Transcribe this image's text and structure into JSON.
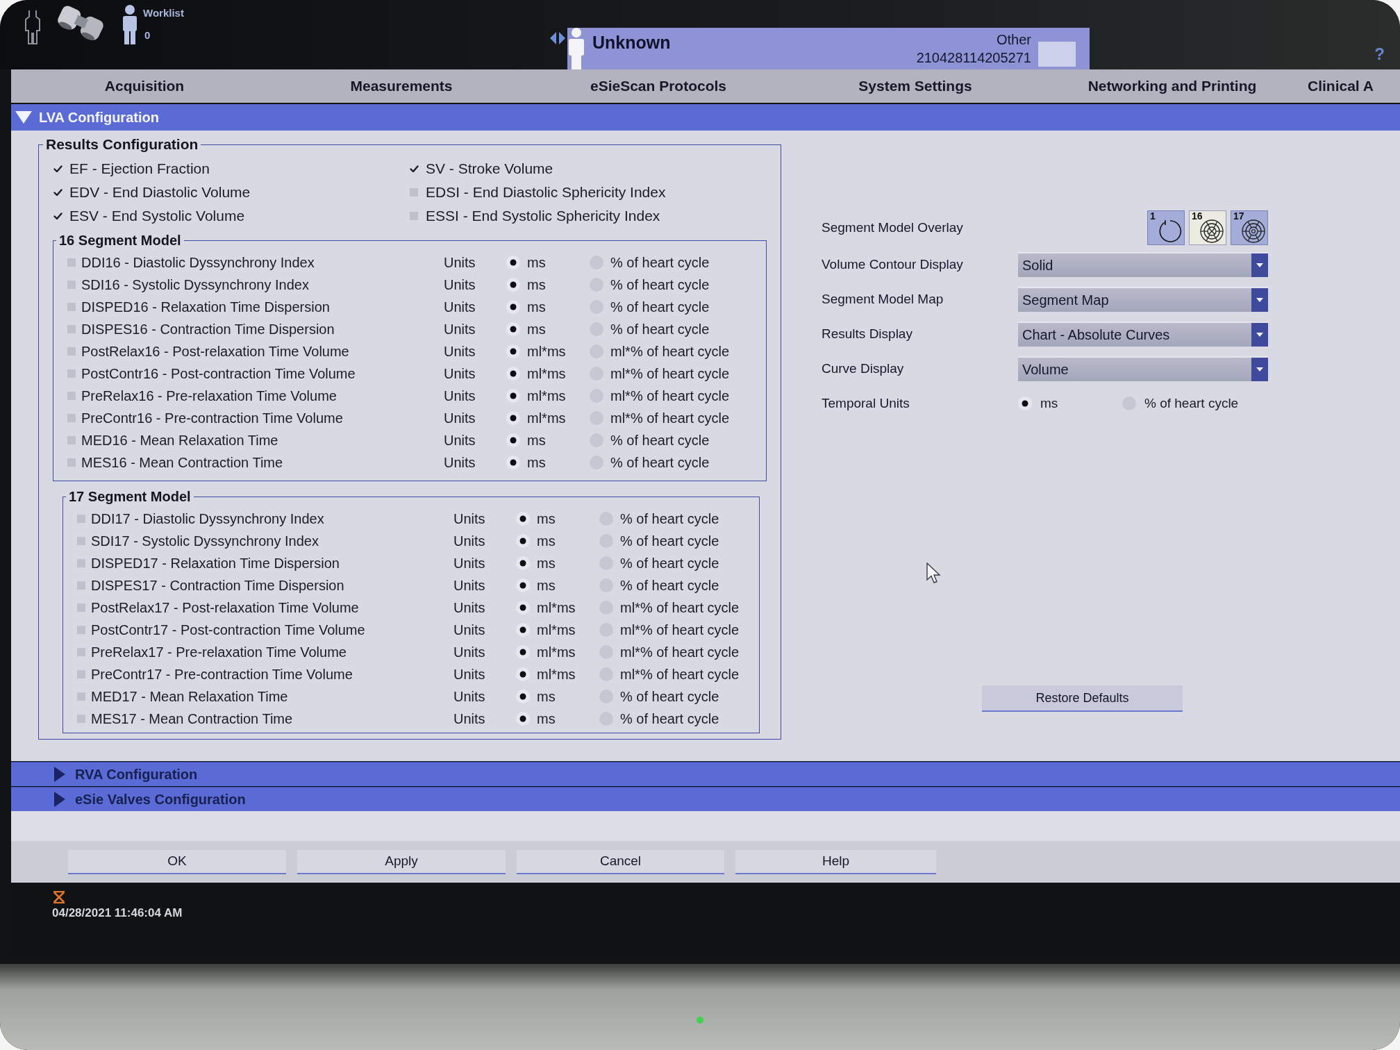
{
  "header": {
    "worklist_label": "Worklist",
    "worklist_count": "0",
    "patient": {
      "name": "Unknown",
      "type": "Other",
      "id": "210428114205271"
    },
    "help": "?"
  },
  "tabs": [
    {
      "label": "Acquisition"
    },
    {
      "label": "Measurements"
    },
    {
      "label": "eSieScan Protocols"
    },
    {
      "label": "System Settings"
    },
    {
      "label": "Networking and Printing"
    },
    {
      "label": "Clinical A"
    }
  ],
  "sections": [
    {
      "title": "LVA Configuration",
      "expanded": true,
      "results_configuration": {
        "title": "Results Configuration",
        "measures_left": [
          {
            "label": "EF - Ejection Fraction",
            "checked": true
          },
          {
            "label": "EDV - End Diastolic Volume",
            "checked": true
          },
          {
            "label": "ESV - End Systolic Volume",
            "checked": true
          }
        ],
        "measures_right": [
          {
            "label": "SV - Stroke Volume",
            "checked": true
          },
          {
            "label": "EDSI - End Diastolic Sphericity Index",
            "checked": false
          },
          {
            "label": "ESSI - End Systolic Sphericity Index",
            "checked": false
          }
        ],
        "segment_models": [
          {
            "title": "16 Segment Model",
            "rows": [
              {
                "label": "DDI16 - Diastolic Dyssynchrony Index",
                "checked": false,
                "units_label": "Units",
                "options": [
                  {
                    "label": "ms",
                    "selected": true
                  },
                  {
                    "label": "% of heart cycle",
                    "selected": false
                  }
                ]
              },
              {
                "label": "SDI16 - Systolic Dyssynchrony Index",
                "checked": false,
                "units_label": "Units",
                "options": [
                  {
                    "label": "ms",
                    "selected": true
                  },
                  {
                    "label": "% of heart cycle",
                    "selected": false
                  }
                ]
              },
              {
                "label": "DISPED16 - Relaxation Time Dispersion",
                "checked": false,
                "units_label": "Units",
                "options": [
                  {
                    "label": "ms",
                    "selected": true
                  },
                  {
                    "label": "% of heart cycle",
                    "selected": false
                  }
                ]
              },
              {
                "label": "DISPES16 - Contraction Time Dispersion",
                "checked": false,
                "units_label": "Units",
                "options": [
                  {
                    "label": "ms",
                    "selected": true
                  },
                  {
                    "label": "% of heart cycle",
                    "selected": false
                  }
                ]
              },
              {
                "label": "PostRelax16 - Post-relaxation Time Volume",
                "checked": false,
                "units_label": "Units",
                "options": [
                  {
                    "label": "ml*ms",
                    "selected": true
                  },
                  {
                    "label": "ml*% of heart cycle",
                    "selected": false
                  }
                ]
              },
              {
                "label": "PostContr16 - Post-contraction Time Volume",
                "checked": false,
                "units_label": "Units",
                "options": [
                  {
                    "label": "ml*ms",
                    "selected": true
                  },
                  {
                    "label": "ml*% of heart cycle",
                    "selected": false
                  }
                ]
              },
              {
                "label": "PreRelax16 - Pre-relaxation Time Volume",
                "checked": false,
                "units_label": "Units",
                "options": [
                  {
                    "label": "ml*ms",
                    "selected": true
                  },
                  {
                    "label": "ml*% of heart cycle",
                    "selected": false
                  }
                ]
              },
              {
                "label": "PreContr16 - Pre-contraction Time Volume",
                "checked": false,
                "units_label": "Units",
                "options": [
                  {
                    "label": "ml*ms",
                    "selected": true
                  },
                  {
                    "label": "ml*% of heart cycle",
                    "selected": false
                  }
                ]
              },
              {
                "label": "MED16 - Mean Relaxation Time",
                "checked": false,
                "units_label": "Units",
                "options": [
                  {
                    "label": "ms",
                    "selected": true
                  },
                  {
                    "label": "% of heart cycle",
                    "selected": false
                  }
                ]
              },
              {
                "label": "MES16 - Mean Contraction Time",
                "checked": false,
                "units_label": "Units",
                "options": [
                  {
                    "label": "ms",
                    "selected": true
                  },
                  {
                    "label": "% of heart cycle",
                    "selected": false
                  }
                ]
              }
            ]
          },
          {
            "title": "17 Segment Model",
            "rows": [
              {
                "label": "DDI17 - Diastolic Dyssynchrony Index",
                "checked": false,
                "units_label": "Units",
                "options": [
                  {
                    "label": "ms",
                    "selected": true
                  },
                  {
                    "label": "% of heart cycle",
                    "selected": false
                  }
                ]
              },
              {
                "label": "SDI17 - Systolic Dyssynchrony Index",
                "checked": false,
                "units_label": "Units",
                "options": [
                  {
                    "label": "ms",
                    "selected": true
                  },
                  {
                    "label": "% of heart cycle",
                    "selected": false
                  }
                ]
              },
              {
                "label": "DISPED17 - Relaxation Time Dispersion",
                "checked": false,
                "units_label": "Units",
                "options": [
                  {
                    "label": "ms",
                    "selected": true
                  },
                  {
                    "label": "% of heart cycle",
                    "selected": false
                  }
                ]
              },
              {
                "label": "DISPES17 - Contraction Time Dispersion",
                "checked": false,
                "units_label": "Units",
                "options": [
                  {
                    "label": "ms",
                    "selected": true
                  },
                  {
                    "label": "% of heart cycle",
                    "selected": false
                  }
                ]
              },
              {
                "label": "PostRelax17 - Post-relaxation Time Volume",
                "checked": false,
                "units_label": "Units",
                "options": [
                  {
                    "label": "ml*ms",
                    "selected": true
                  },
                  {
                    "label": "ml*% of heart cycle",
                    "selected": false
                  }
                ]
              },
              {
                "label": "PostContr17 - Post-contraction Time Volume",
                "checked": false,
                "units_label": "Units",
                "options": [
                  {
                    "label": "ml*ms",
                    "selected": true
                  },
                  {
                    "label": "ml*% of heart cycle",
                    "selected": false
                  }
                ]
              },
              {
                "label": "PreRelax17 - Pre-relaxation Time Volume",
                "checked": false,
                "units_label": "Units",
                "options": [
                  {
                    "label": "ml*ms",
                    "selected": true
                  },
                  {
                    "label": "ml*% of heart cycle",
                    "selected": false
                  }
                ]
              },
              {
                "label": "PreContr17 - Pre-contraction Time Volume",
                "checked": false,
                "units_label": "Units",
                "options": [
                  {
                    "label": "ml*ms",
                    "selected": true
                  },
                  {
                    "label": "ml*% of heart cycle",
                    "selected": false
                  }
                ]
              },
              {
                "label": "MED17 - Mean Relaxation Time",
                "checked": false,
                "units_label": "Units",
                "options": [
                  {
                    "label": "ms",
                    "selected": true
                  },
                  {
                    "label": "% of heart cycle",
                    "selected": false
                  }
                ]
              },
              {
                "label": "MES17 - Mean Contraction Time",
                "checked": false,
                "units_label": "Units",
                "options": [
                  {
                    "label": "ms",
                    "selected": true
                  },
                  {
                    "label": "% of heart cycle",
                    "selected": false
                  }
                ]
              }
            ]
          }
        ]
      },
      "display_settings": {
        "items": [
          {
            "kind": "overlay",
            "label": "Segment Model Overlay",
            "options": [
              {
                "label": "1",
                "selected": false
              },
              {
                "label": "16",
                "selected": true
              },
              {
                "label": "17",
                "selected": false
              }
            ]
          },
          {
            "kind": "dropdown",
            "label": "Volume Contour Display",
            "value": "Solid"
          },
          {
            "kind": "dropdown",
            "label": "Segment Model Map",
            "value": "Segment Map"
          },
          {
            "kind": "dropdown",
            "label": "Results Display",
            "value": "Chart - Absolute Curves"
          },
          {
            "kind": "dropdown",
            "label": "Curve Display",
            "value": "Volume"
          },
          {
            "kind": "radio",
            "label": "Temporal Units",
            "options": [
              {
                "label": "ms",
                "selected": true
              },
              {
                "label": "% of heart cycle",
                "selected": false
              }
            ]
          }
        ],
        "restore_button": "Restore Defaults"
      }
    },
    {
      "title": "RVA Configuration",
      "expanded": false
    },
    {
      "title": "eSie Valves Configuration",
      "expanded": false
    }
  ],
  "dialog_buttons": [
    "OK",
    "Apply",
    "Cancel",
    "Help"
  ],
  "status_bar": {
    "datetime": "04/28/2021 11:46:04 AM"
  }
}
